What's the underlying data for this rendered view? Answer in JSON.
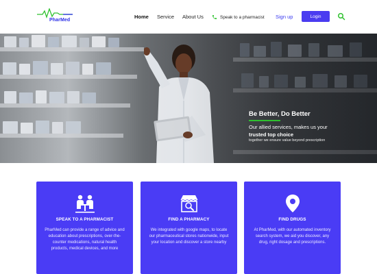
{
  "brand": {
    "name": "PharMed"
  },
  "nav": {
    "home": "Home",
    "service": "Service",
    "about": "About Us",
    "phone_label": "Speak to a pharmacist",
    "signup": "Sign up",
    "login": "Login"
  },
  "hero": {
    "title": "Be Better, Do Better",
    "line1": "Our allied services, makes us your",
    "line2": "trusted top choice",
    "line3": "together we ensure value beyond prescription"
  },
  "cards": [
    {
      "icon": "pharmacist-consult-icon",
      "title": "SPEAK TO A PHARMACIST",
      "text": "PharMed can provide a range of advice and education about prescriptions, over-the-counter medications, natural health products, medical devices, and more"
    },
    {
      "icon": "pharmacy-store-icon",
      "title": "FIND A PHARMACY",
      "text": "We integrated with google maps, to locate our pharmaceutical stores nationwide, input your location and discover a store nearby"
    },
    {
      "icon": "location-pin-icon",
      "title": "FIND DRUGS",
      "text": "At PharMed, with our automated inventory search system, we aid you discover, any drug, right dosage and prescriptions."
    }
  ],
  "colors": {
    "brand_blue": "#4a3cf5",
    "accent_green": "#2ec12e",
    "link_blue": "#3b3bf0"
  }
}
